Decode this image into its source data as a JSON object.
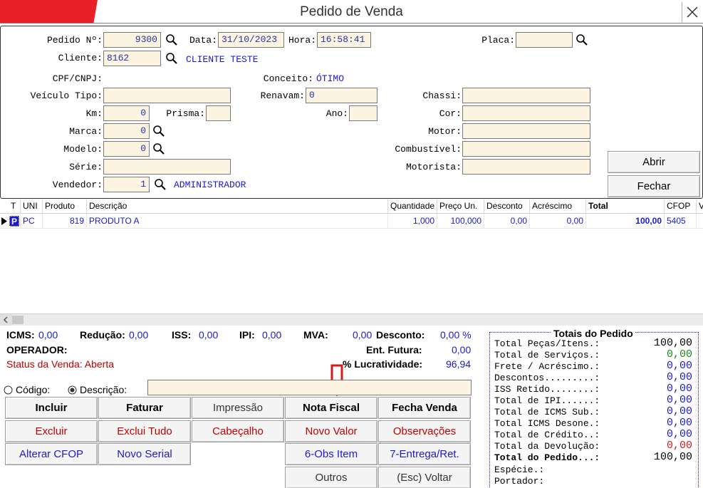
{
  "window": {
    "title": "Pedido de Venda"
  },
  "header": {
    "pedido_label": "Pedido Nº:",
    "pedido_value": "9300",
    "data_label": "Data:",
    "data_value": "31/10/2023",
    "hora_label": "Hora:",
    "hora_value": "16:58:41",
    "placa_label": "Placa:",
    "placa_value": "",
    "cliente_label": "Cliente:",
    "cliente_value": "8162",
    "cliente_name": "CLIENTE TESTE",
    "cpf_label": "CPF/CNPJ:",
    "conceito_label": "Conceito:",
    "conceito_value": "ÓTIMO",
    "veiculo_label": "Veículo Tipo:",
    "veiculo_value": "",
    "renavam_label": "Renavam:",
    "renavam_value": "0",
    "chassi_label": "Chassi:",
    "chassi_value": "",
    "km_label": "Km:",
    "km_value": "0",
    "prisma_label": "Prisma:",
    "prisma_value": "",
    "ano_label": "Ano:",
    "ano_value": "",
    "cor_label": "Cor:",
    "cor_value": "",
    "marca_label": "Marca:",
    "marca_value": "0",
    "motor_label": "Motor:",
    "motor_value": "",
    "modelo_label": "Modelo:",
    "modelo_value": "0",
    "combustivel_label": "Combustível:",
    "combustivel_value": "",
    "serie_label": "Série:",
    "serie_value": "",
    "motorista_label": "Motorista:",
    "motorista_value": "",
    "vendedor_label": "Vendedor:",
    "vendedor_value": "1",
    "vendedor_name": "ADMINISTRADOR",
    "abrir_label": "Abrir",
    "fechar_label": "Fechar"
  },
  "grid": {
    "columns": [
      "T",
      "UNI",
      "Produto",
      "Descrição",
      "Quantidade",
      "Preço Un.",
      "Desconto",
      "Acréscimo",
      "Total",
      "CFOP",
      "V"
    ],
    "rows": [
      {
        "t": "P",
        "uni": "PC",
        "produto": "819",
        "descricao": "PRODUTO A",
        "quantidade": "1,000",
        "preco": "100,000",
        "desconto": "0,00",
        "acrescimo": "0,00",
        "total": "100,00",
        "cfop": "5405"
      }
    ]
  },
  "summary": {
    "icms_label": "ICMS:",
    "icms_value": "0,00",
    "reducao_label": "Redução:",
    "reducao_value": "0,00",
    "iss_label": "ISS:",
    "iss_value": "0,00",
    "ipi_label": "IPI:",
    "ipi_value": "0,00",
    "mva_label": "MVA:",
    "mva_value": "0,00",
    "desconto_label": "Desconto:",
    "desconto_value": "0,00 %",
    "operador_label": "OPERADOR:",
    "entfutura_label": "Ent. Futura:",
    "entfutura_value": "0,00",
    "status_text": "Status da Venda: Aberta",
    "lucratividade_label": "% Lucratividade:",
    "lucratividade_value": "96,94"
  },
  "search": {
    "codigo_label": "Código:",
    "descricao_label": "Descrição:",
    "selected": "descricao",
    "value": ""
  },
  "buttons": {
    "incluir": "Incluir",
    "faturar": "Faturar",
    "impressao": "Impressão",
    "nota_fiscal": "Nota Fiscal",
    "fecha_venda": "Fecha Venda",
    "excluir": "Excluir",
    "exclui_tudo": "Exclui Tudo",
    "cabecalho": "Cabeçalho",
    "novo_valor": "Novo Valor",
    "observacoes": "Observações",
    "alterar_cfop": "Alterar CFOP",
    "novo_serial": "Novo Serial",
    "obs_item": "6-Obs Item",
    "entrega": "7-Entrega/Ret.",
    "outros": "Outros",
    "voltar": "(Esc) Voltar"
  },
  "totals": {
    "title": "Totais do Pedido",
    "lines": [
      {
        "label": "Total Peças/Itens.:",
        "value": "100,00"
      },
      {
        "label": "Total de Serviços.:",
        "value": "0,00"
      },
      {
        "label": "Frete / Acréscimo.:",
        "value": "0,00"
      },
      {
        "label": "Descontos.........:",
        "value": "0,00"
      },
      {
        "label": "ISS Retido........:",
        "value": "0,00"
      },
      {
        "label": "Total de IPI......:",
        "value": "0,00"
      },
      {
        "label": "Total de ICMS Sub.:",
        "value": "0,00"
      },
      {
        "label": "Total ICMS Desone.:",
        "value": "0,00"
      },
      {
        "label": "Total de Crédito..:",
        "value": "0,00"
      },
      {
        "label": "Total da Devolução:",
        "value": "0,00"
      },
      {
        "label": "Total do Pedido...:",
        "value": "100,00"
      }
    ],
    "especie_label": "Espécie.:",
    "portador_label": "Portador:"
  },
  "colors": {
    "field_bg": "#fdf3e1",
    "value_blue": "#1a1acc",
    "brand_red": "#e8202a",
    "arrow_red": "#d61a1a"
  }
}
